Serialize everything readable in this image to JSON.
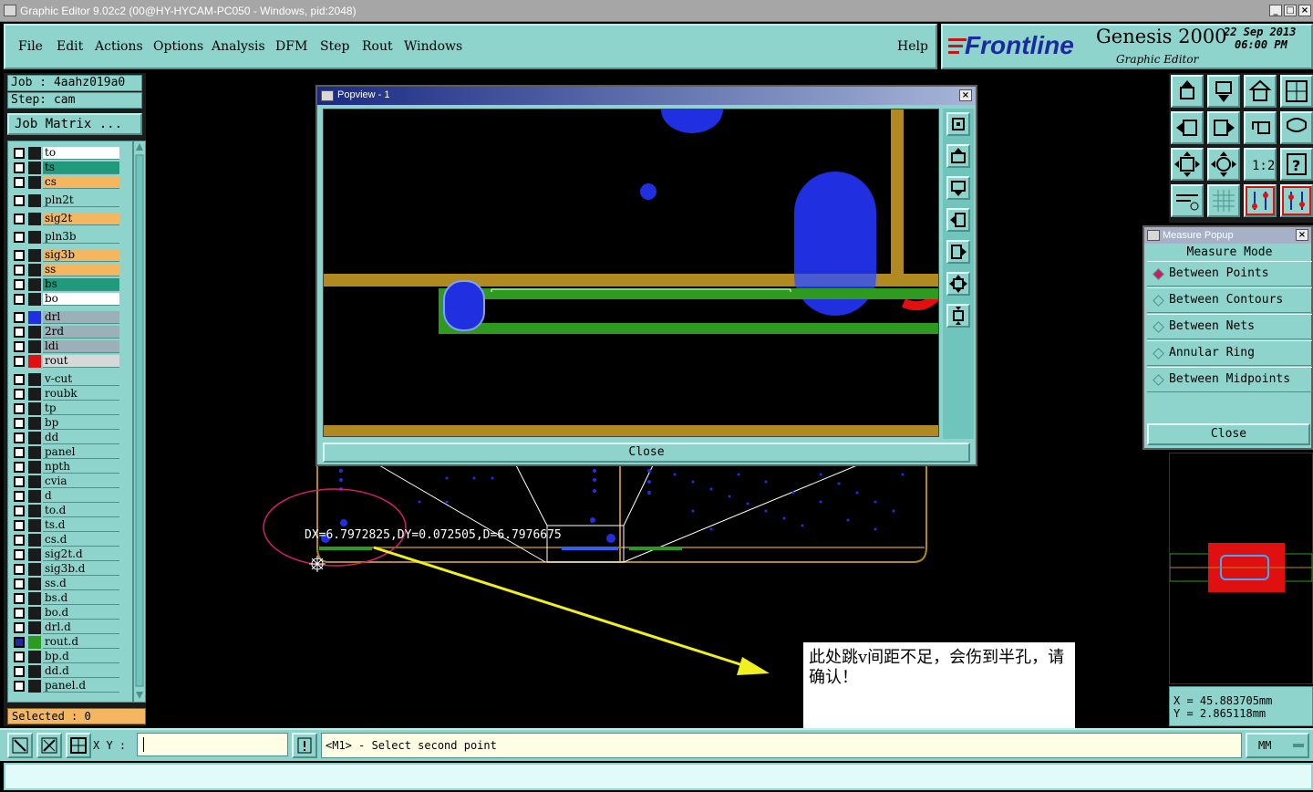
{
  "window": {
    "title": "Graphic Editor 9.02c2 (00@HY-HYCAM-PC050 - Windows, pid:2048)",
    "buttons": [
      "_",
      "□",
      "×"
    ]
  },
  "menu": [
    "File",
    "Edit",
    "Actions",
    "Options",
    "Analysis",
    "DFM",
    "Step",
    "Rout",
    "Windows"
  ],
  "help_label": "Help",
  "brand": {
    "logo": "Frontline",
    "product": "Genesis 2000",
    "subtitle": "Graphic Editor",
    "date": "22 Sep 2013",
    "time": "06:00 PM"
  },
  "job": {
    "job_label": "Job : 4aahz019a0",
    "step_label": "Step: cam",
    "matrix_button": "Job Matrix ..."
  },
  "layers": [
    {
      "name": "to",
      "color": "#ffffff"
    },
    {
      "name": "ts",
      "color": "#1f9a7a"
    },
    {
      "name": "cs",
      "color": "#f4b660"
    },
    {
      "name": "pln2t",
      "color": "#8ed4cc"
    },
    {
      "name": "sig2t",
      "color": "#f4b660"
    },
    {
      "name": "pln3b",
      "color": "#8ed4cc"
    },
    {
      "name": "sig3b",
      "color": "#f4b660"
    },
    {
      "name": "ss",
      "color": "#f4b660"
    },
    {
      "name": "bs",
      "color": "#1f9a7a"
    },
    {
      "name": "bo",
      "color": "#ffffff"
    },
    {
      "name": "drl",
      "color": "#9bb0b8",
      "swatch": "#2030e0"
    },
    {
      "name": "2rd",
      "color": "#9bb0b8"
    },
    {
      "name": "ldi",
      "color": "#9bb0b8"
    },
    {
      "name": "rout",
      "color": "#d8d8d8",
      "swatch": "#e01010"
    },
    {
      "name": "v-cut",
      "color": "#8ed4cc"
    },
    {
      "name": "roubk",
      "color": "#8ed4cc"
    },
    {
      "name": "tp",
      "color": "#8ed4cc"
    },
    {
      "name": "bp",
      "color": "#8ed4cc"
    },
    {
      "name": "dd",
      "color": "#8ed4cc"
    },
    {
      "name": "panel",
      "color": "#8ed4cc"
    },
    {
      "name": "npth",
      "color": "#8ed4cc"
    },
    {
      "name": "cvia",
      "color": "#8ed4cc"
    },
    {
      "name": "d",
      "color": "#8ed4cc"
    },
    {
      "name": "to.d",
      "color": "#8ed4cc"
    },
    {
      "name": "ts.d",
      "color": "#8ed4cc"
    },
    {
      "name": "cs.d",
      "color": "#8ed4cc"
    },
    {
      "name": "sig2t.d",
      "color": "#8ed4cc"
    },
    {
      "name": "sig3b.d",
      "color": "#8ed4cc"
    },
    {
      "name": "ss.d",
      "color": "#8ed4cc"
    },
    {
      "name": "bs.d",
      "color": "#8ed4cc"
    },
    {
      "name": "bo.d",
      "color": "#8ed4cc"
    },
    {
      "name": "drl.d",
      "color": "#8ed4cc"
    },
    {
      "name": "rout.d",
      "color": "#8ed4cc",
      "swatch": "#2f9a20",
      "checked": true
    },
    {
      "name": "bp.d",
      "color": "#8ed4cc"
    },
    {
      "name": "dd.d",
      "color": "#8ed4cc"
    },
    {
      "name": "panel.d",
      "color": "#8ed4cc"
    }
  ],
  "selected_label": "Selected : 0",
  "popview": {
    "title": "Popview - 1",
    "close_label": "Close"
  },
  "measure_popup": {
    "title": "Measure Popup",
    "header": "Measure Mode",
    "modes": [
      "Between Points",
      "Between Contours",
      "Between Nets",
      "Annular Ring",
      "Between Midpoints"
    ],
    "selected_index": 0,
    "close_label": "Close"
  },
  "coords": {
    "x_label": "X = 45.883705mm",
    "y_label": "Y = 2.865118mm"
  },
  "bottom": {
    "xy_label": "X Y :",
    "xy_value": "",
    "prompt": "<M1> - Select second point",
    "unit": "MM"
  },
  "measurement_text": "DX=6.7972825,DY=0.072505,D=6.7976675",
  "annotation_note": "此处跳v间距不足，会伤到半孔，请确认！",
  "tool_icons": [
    "zoom-home-icon",
    "zoom-in-box-icon",
    "home-icon",
    "window-split-icon",
    "pan-left-icon",
    "pan-right-icon",
    "undo-view-icon",
    "redraw-icon",
    "fit-screen-icon",
    "zoom-center-icon",
    "one-to-one-icon",
    "help-icon",
    "measure-ruler-icon",
    "grid-icon",
    "net-trace-icon",
    "net-highlight-icon"
  ]
}
